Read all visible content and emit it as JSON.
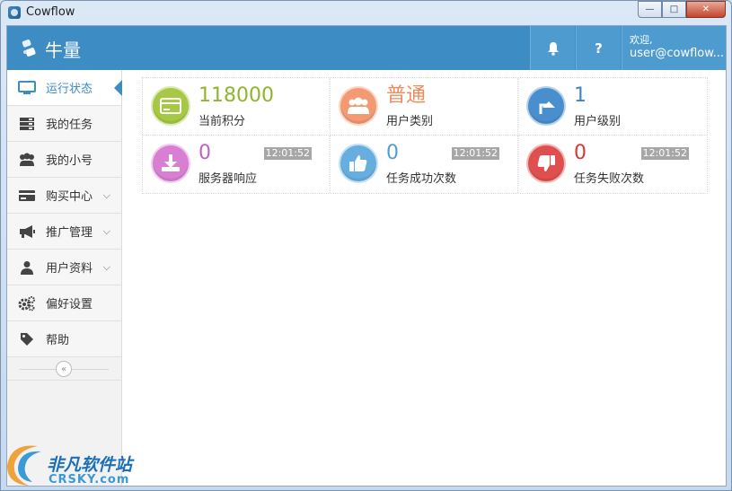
{
  "window": {
    "title": "Cowflow",
    "min_glyph": "—",
    "max_glyph": "□",
    "close_glyph": "✕"
  },
  "header": {
    "logo_text": "牛量",
    "bell_icon": "bell-icon",
    "help_label": "?",
    "user_greeting": "欢迎,",
    "user_email": "user@cowflow..."
  },
  "sidebar": {
    "items": [
      {
        "label": "运行状态",
        "icon": "monitor-icon",
        "active": true
      },
      {
        "label": "我的任务",
        "icon": "tasks-icon"
      },
      {
        "label": "我的小号",
        "icon": "users-icon"
      },
      {
        "label": "购买中心",
        "icon": "card-icon",
        "expandable": true
      },
      {
        "label": "推广管理",
        "icon": "megaphone-icon",
        "expandable": true
      },
      {
        "label": "用户资料",
        "icon": "user-icon",
        "expandable": true
      },
      {
        "label": "偏好设置",
        "icon": "gears-icon"
      },
      {
        "label": "帮助",
        "icon": "tag-icon"
      }
    ],
    "expand_glyph": "⌵",
    "collapse_glyph": "«"
  },
  "stats": [
    {
      "value": "118000",
      "label": "当前积分",
      "color": "#a6c845",
      "icon": "credit-card-icon"
    },
    {
      "value": "普通",
      "label": "用户类别",
      "color": "#f49a73",
      "icon": "group-icon"
    },
    {
      "value": "1",
      "label": "用户级别",
      "color": "#4a8fcd",
      "icon": "level-up-icon"
    },
    {
      "value": "0",
      "label": "服务器响应",
      "color": "#d97fd3",
      "icon": "download-icon",
      "time": "12:01:52"
    },
    {
      "value": "0",
      "label": "任务成功次数",
      "color": "#67aee0",
      "icon": "thumbs-up-icon",
      "time": "12:01:52"
    },
    {
      "value": "0",
      "label": "任务失败次数",
      "color": "#e04f4f",
      "icon": "thumbs-down-icon",
      "time": "12:01:52"
    }
  ],
  "watermark": {
    "line1": "非凡软件站",
    "line2": "CRSKY.com"
  }
}
